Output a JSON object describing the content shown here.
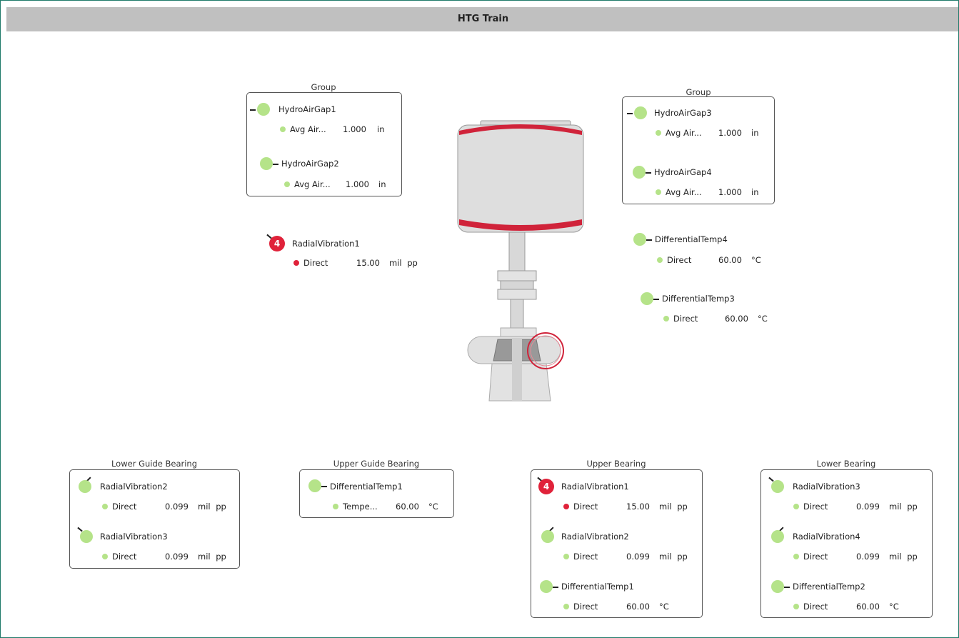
{
  "window": {
    "title": "HTG Train"
  },
  "groups": {
    "group_left": {
      "title": "Group"
    },
    "group_right": {
      "title": "Group"
    },
    "lower_guide_bearing": {
      "title": "Lower Guide Bearing"
    },
    "upper_guide_bearing": {
      "title": "Upper Guide Bearing"
    },
    "upper_bearing": {
      "title": "Upper Bearing"
    },
    "lower_bearing": {
      "title": "Lower Bearing"
    }
  },
  "sensors": {
    "hag1": {
      "name": "HydroAirGap1",
      "label": "Avg Air...",
      "value": "1.000",
      "unit": "in"
    },
    "hag2": {
      "name": "HydroAirGap2",
      "label": "Avg Air...",
      "value": "1.000",
      "unit": "in"
    },
    "hag3": {
      "name": "HydroAirGap3",
      "label": "Avg Air...",
      "value": "1.000",
      "unit": "in"
    },
    "hag4": {
      "name": "HydroAirGap4",
      "label": "Avg Air...",
      "value": "1.000",
      "unit": "in"
    },
    "rv1_float": {
      "name": "RadialVibration1",
      "alarm_count": "4",
      "label": "Direct",
      "value": "15.00",
      "unit": "mil pp"
    },
    "dt4_float": {
      "name": "DifferentialTemp4",
      "label": "Direct",
      "value": "60.00",
      "unit": "°C"
    },
    "dt3_float": {
      "name": "DifferentialTemp3",
      "label": "Direct",
      "value": "60.00",
      "unit": "°C"
    },
    "lgb_rv2": {
      "name": "RadialVibration2",
      "label": "Direct",
      "value": "0.099",
      "unit": "mil pp"
    },
    "lgb_rv3": {
      "name": "RadialVibration3",
      "label": "Direct",
      "value": "0.099",
      "unit": "mil pp"
    },
    "ugb_dt1": {
      "name": "DifferentialTemp1",
      "label": "Tempe...",
      "value": "60.00",
      "unit": "°C"
    },
    "ub_rv1": {
      "name": "RadialVibration1",
      "alarm_count": "4",
      "label": "Direct",
      "value": "15.00",
      "unit": "mil pp"
    },
    "ub_rv2": {
      "name": "RadialVibration2",
      "label": "Direct",
      "value": "0.099",
      "unit": "mil pp"
    },
    "ub_dt1": {
      "name": "DifferentialTemp1",
      "label": "Direct",
      "value": "60.00",
      "unit": "°C"
    },
    "lb_rv3": {
      "name": "RadialVibration3",
      "label": "Direct",
      "value": "0.099",
      "unit": "mil pp"
    },
    "lb_rv4": {
      "name": "RadialVibration4",
      "label": "Direct",
      "value": "0.099",
      "unit": "mil pp"
    },
    "lb_dt2": {
      "name": "DifferentialTemp2",
      "label": "Direct",
      "value": "60.00",
      "unit": "°C"
    }
  },
  "colors": {
    "ok": "#b5e389",
    "alarm": "#e0223a",
    "frame": "#1f7a6a",
    "titlebar": "#c0c0c0"
  }
}
